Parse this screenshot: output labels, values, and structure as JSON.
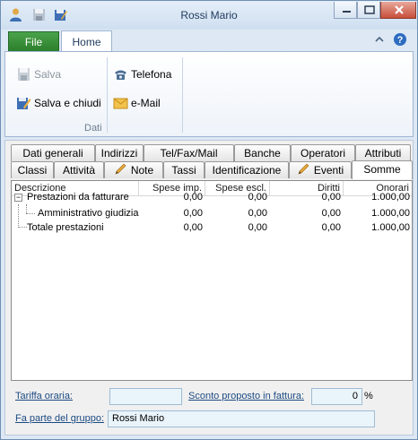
{
  "window": {
    "title": "Rossi Mario"
  },
  "ribbon": {
    "tabs": [
      {
        "label": "File"
      },
      {
        "label": "Home"
      }
    ],
    "buttons": {
      "salva": "Salva",
      "salva_chiudi": "Salva e chiudi",
      "telefona": "Telefona",
      "email": "e-Mail"
    },
    "group_label": "Dati"
  },
  "tabs_row1": [
    "Dati generali",
    "Indirizzi",
    "Tel/Fax/Mail",
    "Banche",
    "Operatori",
    "Attributi"
  ],
  "tabs_row2": [
    "Classi",
    "Attività",
    "Note",
    "Tassi",
    "Identificazione",
    "Eventi",
    "Somme"
  ],
  "grid": {
    "columns": [
      "Descrizione",
      "Spese imp.",
      "Spese escl.",
      "Diritti",
      "Onorari"
    ],
    "rows": [
      {
        "descr": "Prestazioni da fatturare",
        "spese_imp": "0,00",
        "spese_escl": "0,00",
        "diritti": "0,00",
        "onorari": "1.000,00"
      },
      {
        "descr": "Amministrativo giudiziale",
        "spese_imp": "0,00",
        "spese_escl": "0,00",
        "diritti": "0,00",
        "onorari": "1.000,00"
      },
      {
        "descr": "Totale prestazioni",
        "spese_imp": "0,00",
        "spese_escl": "0,00",
        "diritti": "0,00",
        "onorari": "1.000,00"
      }
    ]
  },
  "footer": {
    "tariffa_label": "Tariffa oraria:",
    "tariffa_value": "",
    "sconto_label": "Sconto proposto in fattura:",
    "sconto_value": "0",
    "sconto_unit": "%",
    "gruppo_label": "Fa parte del gruppo:",
    "gruppo_value": "Rossi Mario"
  }
}
